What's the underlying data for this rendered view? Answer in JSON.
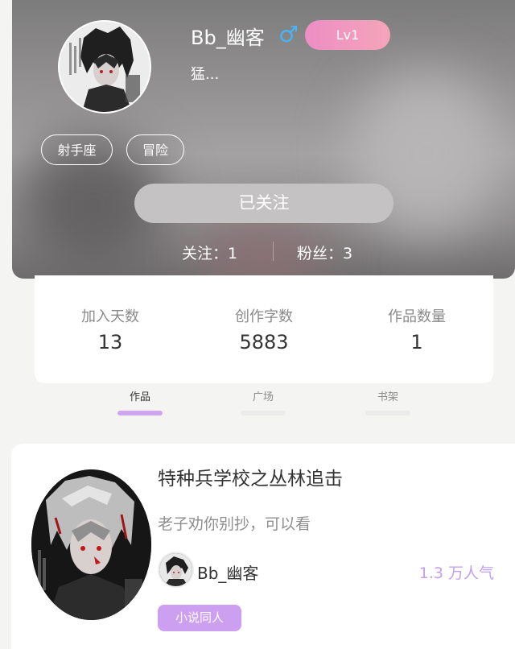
{
  "profile": {
    "username": "Bb_幽客",
    "gender_icon": "male-icon",
    "gender_symbol": "♂",
    "level": "Lv1",
    "bio": "猛...",
    "tags": [
      "射手座",
      "冒险"
    ],
    "follow_button": "已关注",
    "following": "关注：1",
    "followers": "粉丝：3"
  },
  "stats": [
    {
      "label": "加入天数",
      "value": "13"
    },
    {
      "label": "创作字数",
      "value": "5883"
    },
    {
      "label": "作品数量",
      "value": "1"
    }
  ],
  "tabs": [
    {
      "label": "作品",
      "active": true
    },
    {
      "label": "广场",
      "active": false
    },
    {
      "label": "书架",
      "active": false
    }
  ],
  "work": {
    "title": "特种兵学校之丛林追击",
    "description": "老子劝你别抄，可以看",
    "author": "Bb_幽客",
    "popularity": "1.3 万人气",
    "genre": "小说同人"
  },
  "colors": {
    "accent_purple": "#cc9ff0",
    "popularity_purple": "#c3a0ee",
    "gender_blue": "#4db2f3",
    "level_pink": "#ed8dc4"
  }
}
